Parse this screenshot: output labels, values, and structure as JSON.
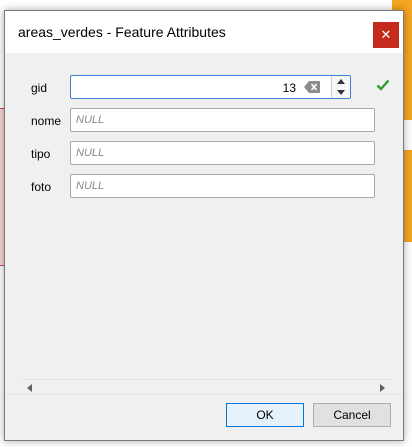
{
  "window": {
    "title": "areas_verdes - Feature Attributes",
    "close_symbol": "✕"
  },
  "fields": {
    "gid": {
      "label": "gid",
      "value": "13"
    },
    "nome": {
      "label": "nome",
      "placeholder": "NULL"
    },
    "tipo": {
      "label": "tipo",
      "placeholder": "NULL"
    },
    "foto": {
      "label": "foto",
      "placeholder": "NULL"
    }
  },
  "buttons": {
    "ok_label": "OK",
    "cancel_label": "Cancel"
  },
  "colors": {
    "focus_border": "#3d7fd3",
    "close_button": "#c42b1c",
    "valid_check": "#2e9d2e",
    "background_highlight": "#f5a623"
  },
  "icons": {
    "clear": "clear-icon",
    "spin_up": "spin-up-icon",
    "spin_down": "spin-down-icon",
    "valid": "checkmark-icon"
  }
}
